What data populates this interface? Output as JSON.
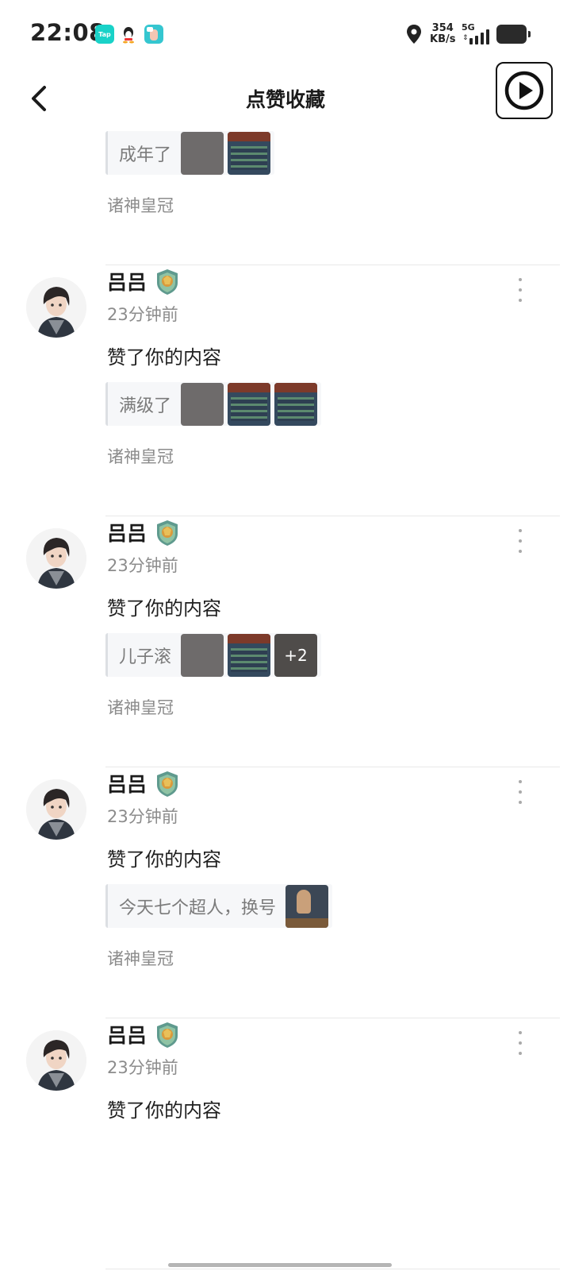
{
  "status_bar": {
    "time": "22:08",
    "tap_app": "Tap",
    "net_speed_value": "354",
    "net_speed_unit": "KB/s",
    "network": "5G",
    "icons": [
      "taptap-icon",
      "qq-icon",
      "app-icon",
      "location-icon",
      "signal-icon",
      "battery-icon"
    ]
  },
  "nav": {
    "title": "点赞收藏",
    "back_icon": "chevron-left-icon",
    "float_icon": "play-circle-icon"
  },
  "feed": [
    {
      "user": "吕吕",
      "time": "23分钟前",
      "action": "赞了你的内容",
      "quote": "成年了",
      "thumbs": [
        "grey",
        "game"
      ],
      "more_count": "",
      "game": "诸神皇冠"
    },
    {
      "user": "吕吕",
      "time": "23分钟前",
      "action": "赞了你的内容",
      "quote": "满级了",
      "thumbs": [
        "grey",
        "game",
        "game"
      ],
      "more_count": "",
      "game": "诸神皇冠"
    },
    {
      "user": "吕吕",
      "time": "23分钟前",
      "action": "赞了你的内容",
      "quote": "儿子滚",
      "thumbs": [
        "grey",
        "game"
      ],
      "more_count": "+2",
      "game": "诸神皇冠"
    },
    {
      "user": "吕吕",
      "time": "23分钟前",
      "action": "赞了你的内容",
      "quote": "今天七个超人，换号",
      "thumbs": [
        "portrait"
      ],
      "more_count": "",
      "game": "诸神皇冠"
    },
    {
      "user": "吕吕",
      "time": "23分钟前",
      "action": "赞了你的内容",
      "quote": "",
      "thumbs": [],
      "more_count": "",
      "game": ""
    }
  ],
  "colors": {
    "accent": "#1f1f1f",
    "secondary_text": "#8c8c8c",
    "divider": "#e8e8e8"
  }
}
